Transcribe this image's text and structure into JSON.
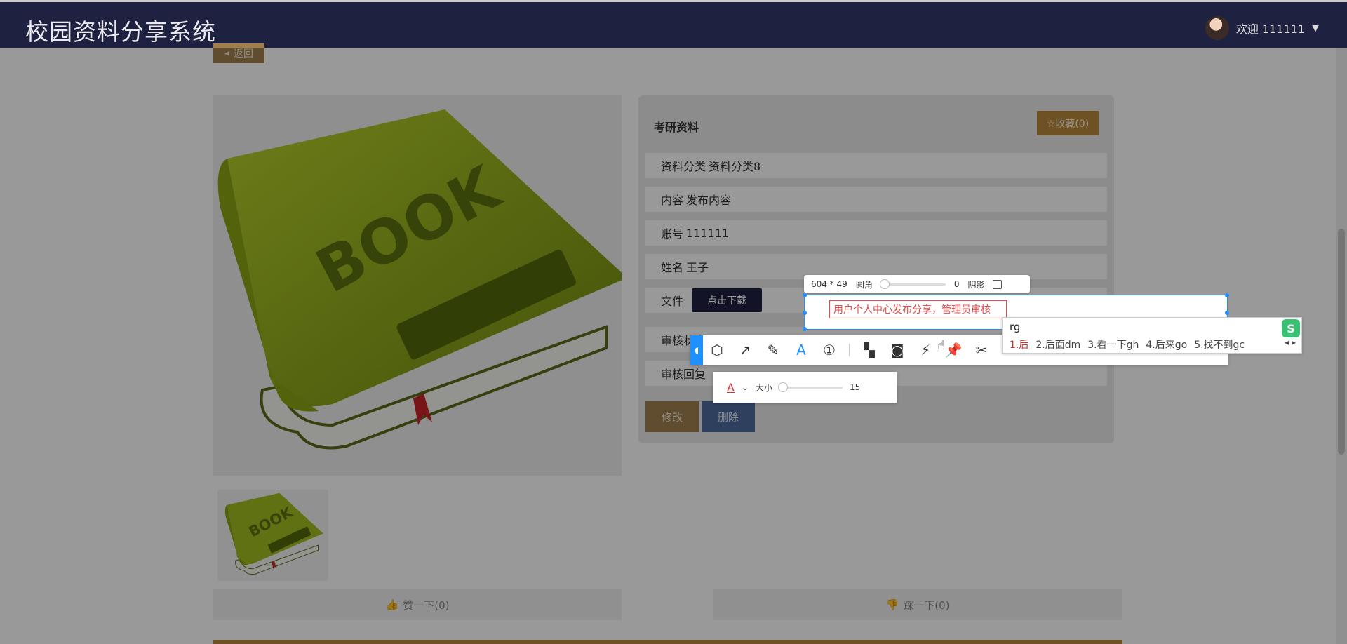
{
  "header": {
    "title": "校园资料分享系统",
    "welcome": "欢迎 111111",
    "caret": "▼"
  },
  "nav": {
    "back_label": "返回"
  },
  "detail": {
    "title": "考研资料",
    "favorite_label": "☆收藏(0)",
    "rows": [
      {
        "key": "资料分类",
        "value": "资料分类8"
      },
      {
        "key": "内容",
        "value": "发布内容"
      },
      {
        "key": "账号",
        "value": "111111"
      },
      {
        "key": "姓名",
        "value": "王子"
      },
      {
        "key": "文件",
        "value": ""
      },
      {
        "key": "审核状态",
        "value": ""
      },
      {
        "key": "审核回复",
        "value": ""
      }
    ],
    "download_label": "点击下载",
    "edit_label": "修改",
    "delete_label": "删除"
  },
  "votes": {
    "like_label": "赞一下(0)",
    "dislike_label": "踩一下(0)"
  },
  "capture": {
    "size_readout": "604 * 49",
    "radius_label": "圆角",
    "radius_value": "0",
    "shadow_label": "阴影",
    "annotation_text": "用户个人中心发布分享，管理员审核",
    "font_size_label": "大小",
    "font_size_value": "15",
    "font_color_glyph": "A"
  },
  "ime": {
    "input": "rg",
    "candidates": [
      "1.后",
      "2.后面dm",
      "3.看一下gh",
      "4.后来go",
      "5.找不到gc"
    ]
  },
  "colors": {
    "header_bg": "#1e2140",
    "accent_brown": "#a07f4d",
    "accent_blue": "#1e90ff"
  }
}
